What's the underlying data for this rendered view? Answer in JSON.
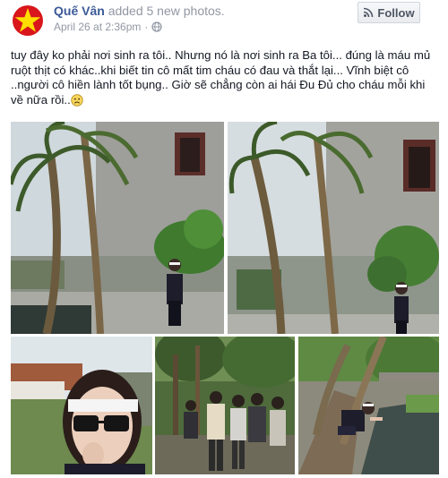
{
  "post": {
    "author": "Quế Vân",
    "action": "added 5 new photos.",
    "timestamp": "April 26 at 2:36pm",
    "follow_label": "Follow",
    "caption_lines": [
      "tuy đây ko phải nơi sinh ra tôi.. Nhưng nó là nơi sinh ra Ba tôi... đúng là máu mủ",
      "ruột thịt có khác..khi biết tin cô mất tim cháu có đau và thắt lại... Vĩnh biệt cô",
      "..người cô hiền lành tốt bụng.. Giờ sẽ chẳng còn ai hái Đu Đủ cho cháu mỗi khi",
      "về nữa rồi.."
    ]
  },
  "colors": {
    "author_link": "#3b5998",
    "meta_text": "#9197a3",
    "body_text": "#141823",
    "avatar_red": "#d8161b",
    "avatar_star": "#ffde00"
  },
  "icons": {
    "avatar": "vietnam-flag-star",
    "privacy": "globe-icon",
    "follow": "rss-icon",
    "caption_end": "sad-face-emoji"
  },
  "photos": [
    {
      "id": "photo-1",
      "subject": "woman-with-palm-trees-by-pond"
    },
    {
      "id": "photo-2",
      "subject": "woman-standing-by-palm-trees"
    },
    {
      "id": "photo-3",
      "subject": "close-up-woman-with-headband-and-sunglasses"
    },
    {
      "id": "photo-4",
      "subject": "funeral-gathering-under-trees"
    },
    {
      "id": "photo-5",
      "subject": "woman-crouching-by-pond"
    }
  ]
}
